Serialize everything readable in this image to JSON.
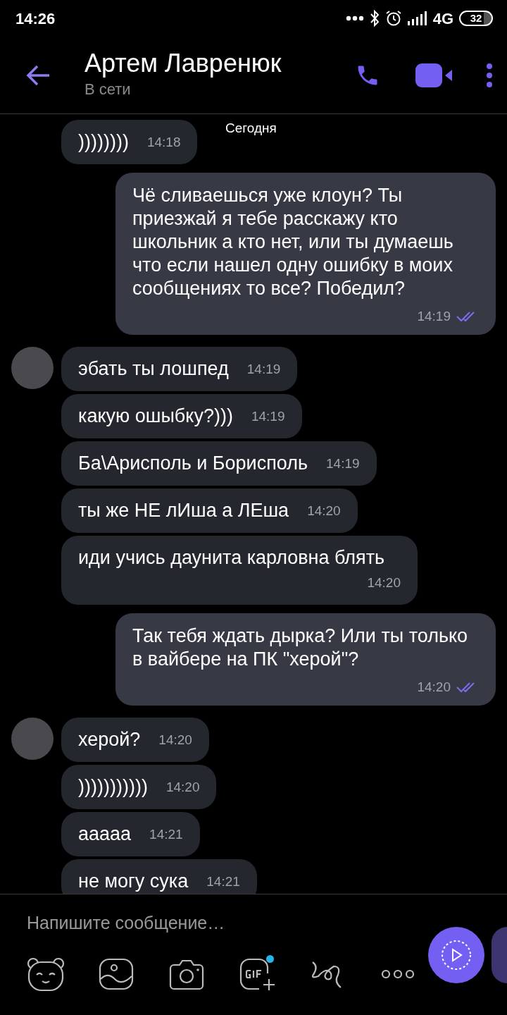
{
  "status_bar": {
    "time": "14:26",
    "network": "4G",
    "battery": "32"
  },
  "header": {
    "name": "Артем Лавренюк",
    "status": "В сети"
  },
  "date_label": "Сегодня",
  "messages": [
    {
      "kind": "incoming",
      "avatar": false,
      "text": "))))))))",
      "time": "14:18"
    },
    {
      "kind": "outgoing",
      "read": true,
      "text": "Чё сливаешься уже клоун? Ты приезжай я тебе расскажу кто школьник а кто нет, или ты думаешь что если нашел одну ошибку в моих сообщениях то все? Победил?",
      "time": "14:19"
    },
    {
      "kind": "incoming",
      "avatar": true,
      "text": "эбать ты лошпед",
      "time": "14:19"
    },
    {
      "kind": "incoming",
      "avatar": false,
      "text": "какую ошыбку?)))",
      "time": "14:19"
    },
    {
      "kind": "incoming",
      "avatar": false,
      "text": "Ба\\Арисполь и Борисполь",
      "time": "14:19"
    },
    {
      "kind": "incoming",
      "avatar": false,
      "text": "ты же НЕ лИша а ЛЕша",
      "time": "14:20"
    },
    {
      "kind": "incoming",
      "avatar": false,
      "text": "иди учись даунита карловна блять",
      "time": "14:20"
    },
    {
      "kind": "outgoing",
      "read": true,
      "text": "Так тебя ждать дырка? Или ты только в вайбере на ПК \"херой\"?",
      "time": "14:20"
    },
    {
      "kind": "incoming",
      "avatar": true,
      "text": "херой?",
      "time": "14:20"
    },
    {
      "kind": "incoming",
      "avatar": false,
      "text": ")))))))))))",
      "time": "14:20"
    },
    {
      "kind": "incoming",
      "avatar": false,
      "text": "ааааа",
      "time": "14:21"
    },
    {
      "kind": "incoming",
      "avatar": false,
      "text": "не могу сука",
      "time": "14:21"
    }
  ],
  "composer": {
    "placeholder": "Напишите сообщение…",
    "gif_new": true
  }
}
